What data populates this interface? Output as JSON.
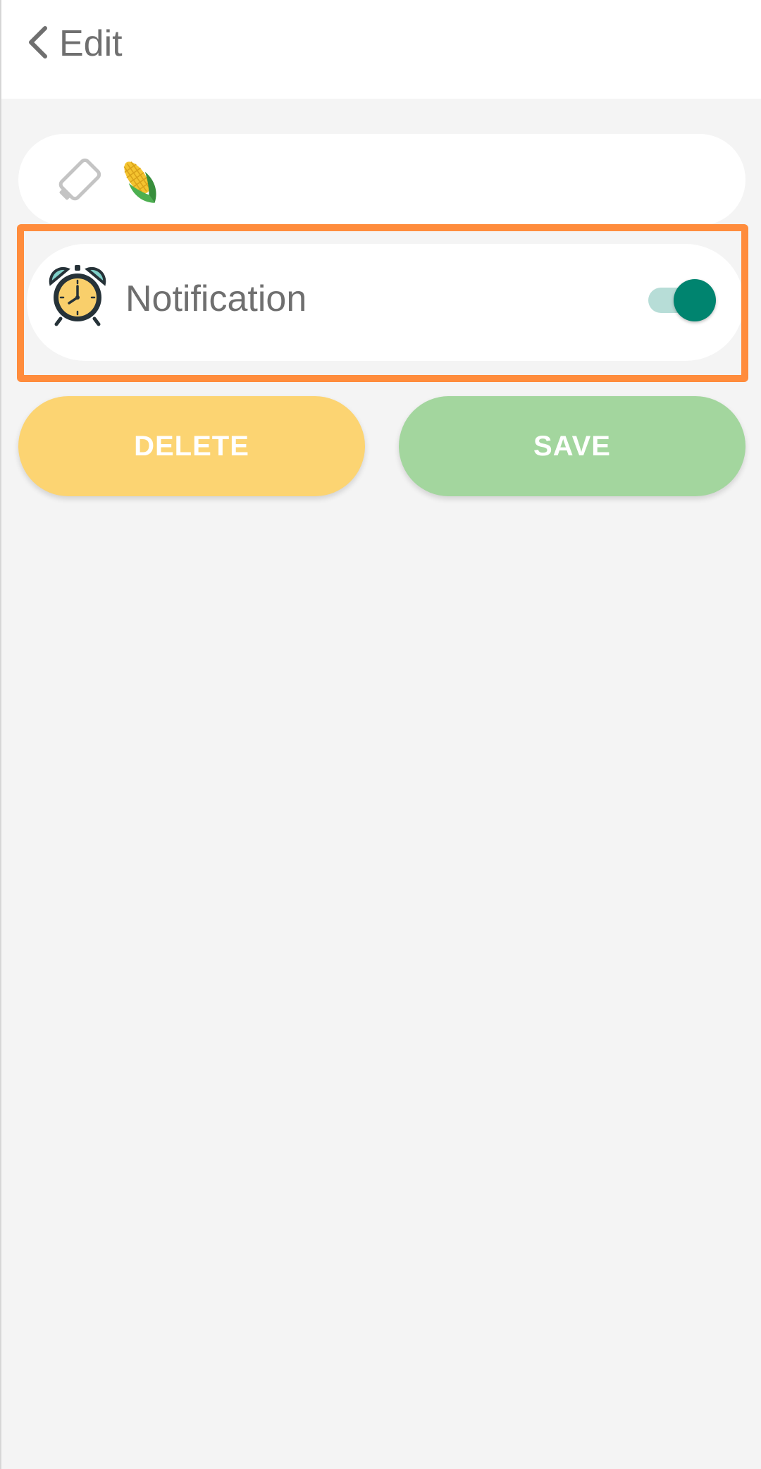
{
  "header": {
    "title": "Edit",
    "back_icon": "chevron-left-icon"
  },
  "tag_row": {
    "tag_icon": "tag-icon",
    "emoji_icon": "corn-icon"
  },
  "notification": {
    "label": "Notification",
    "icon": "alarm-clock-icon",
    "enabled": true,
    "highlight_color": "#ff8c3c"
  },
  "actions": {
    "delete_label": "DELETE",
    "save_label": "SAVE",
    "delete_color": "#fcd472",
    "save_color": "#a3d69e"
  },
  "colors": {
    "toggle_on": "#00846f",
    "background": "#f4f4f4"
  }
}
